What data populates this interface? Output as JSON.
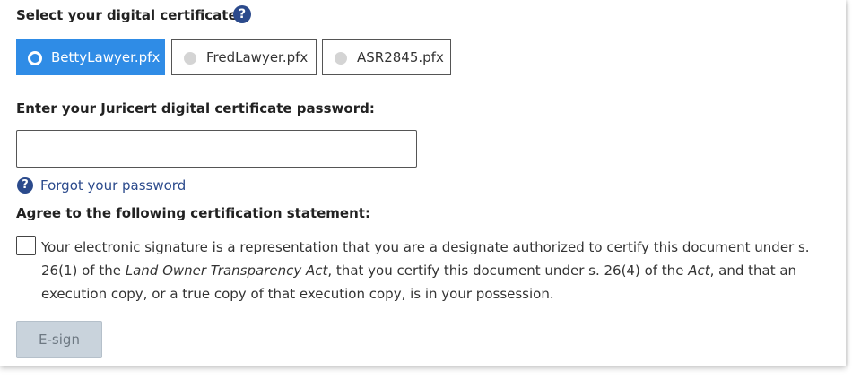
{
  "certificate_section": {
    "heading": "Select your digital certificate:",
    "help_icon": "question-circle-icon",
    "help_glyph": "?",
    "options": [
      {
        "label": "BettyLawyer.pfx",
        "selected": true
      },
      {
        "label": "FredLawyer.pfx",
        "selected": false
      },
      {
        "label": "ASR2845.pfx",
        "selected": false
      }
    ]
  },
  "password_section": {
    "heading": "Enter your Juricert digital certificate password:",
    "input_value": "",
    "forgot_icon": "question-circle-icon",
    "forgot_glyph": "?",
    "forgot_link": "Forgot your password"
  },
  "agreement_section": {
    "heading": "Agree to the following certification statement:",
    "checked": false,
    "statement": {
      "part1": "Your electronic signature is a representation that you are a designate authorized to certify this document under s. 26(1) of the ",
      "act_name": "Land Owner Transparency Act",
      "part2": ", that you certify this document under s. 26(4) of the ",
      "act_short": "Act",
      "part3": ", and that an execution copy, or a true copy of that execution copy, is in your possession."
    }
  },
  "actions": {
    "esign_label": "E-sign",
    "esign_enabled": false
  },
  "colors": {
    "selected_option": "#2f8ce6",
    "link": "#2b4a8c",
    "help_icon": "#2b4a8c",
    "disabled_button": "#c9d3dc"
  }
}
